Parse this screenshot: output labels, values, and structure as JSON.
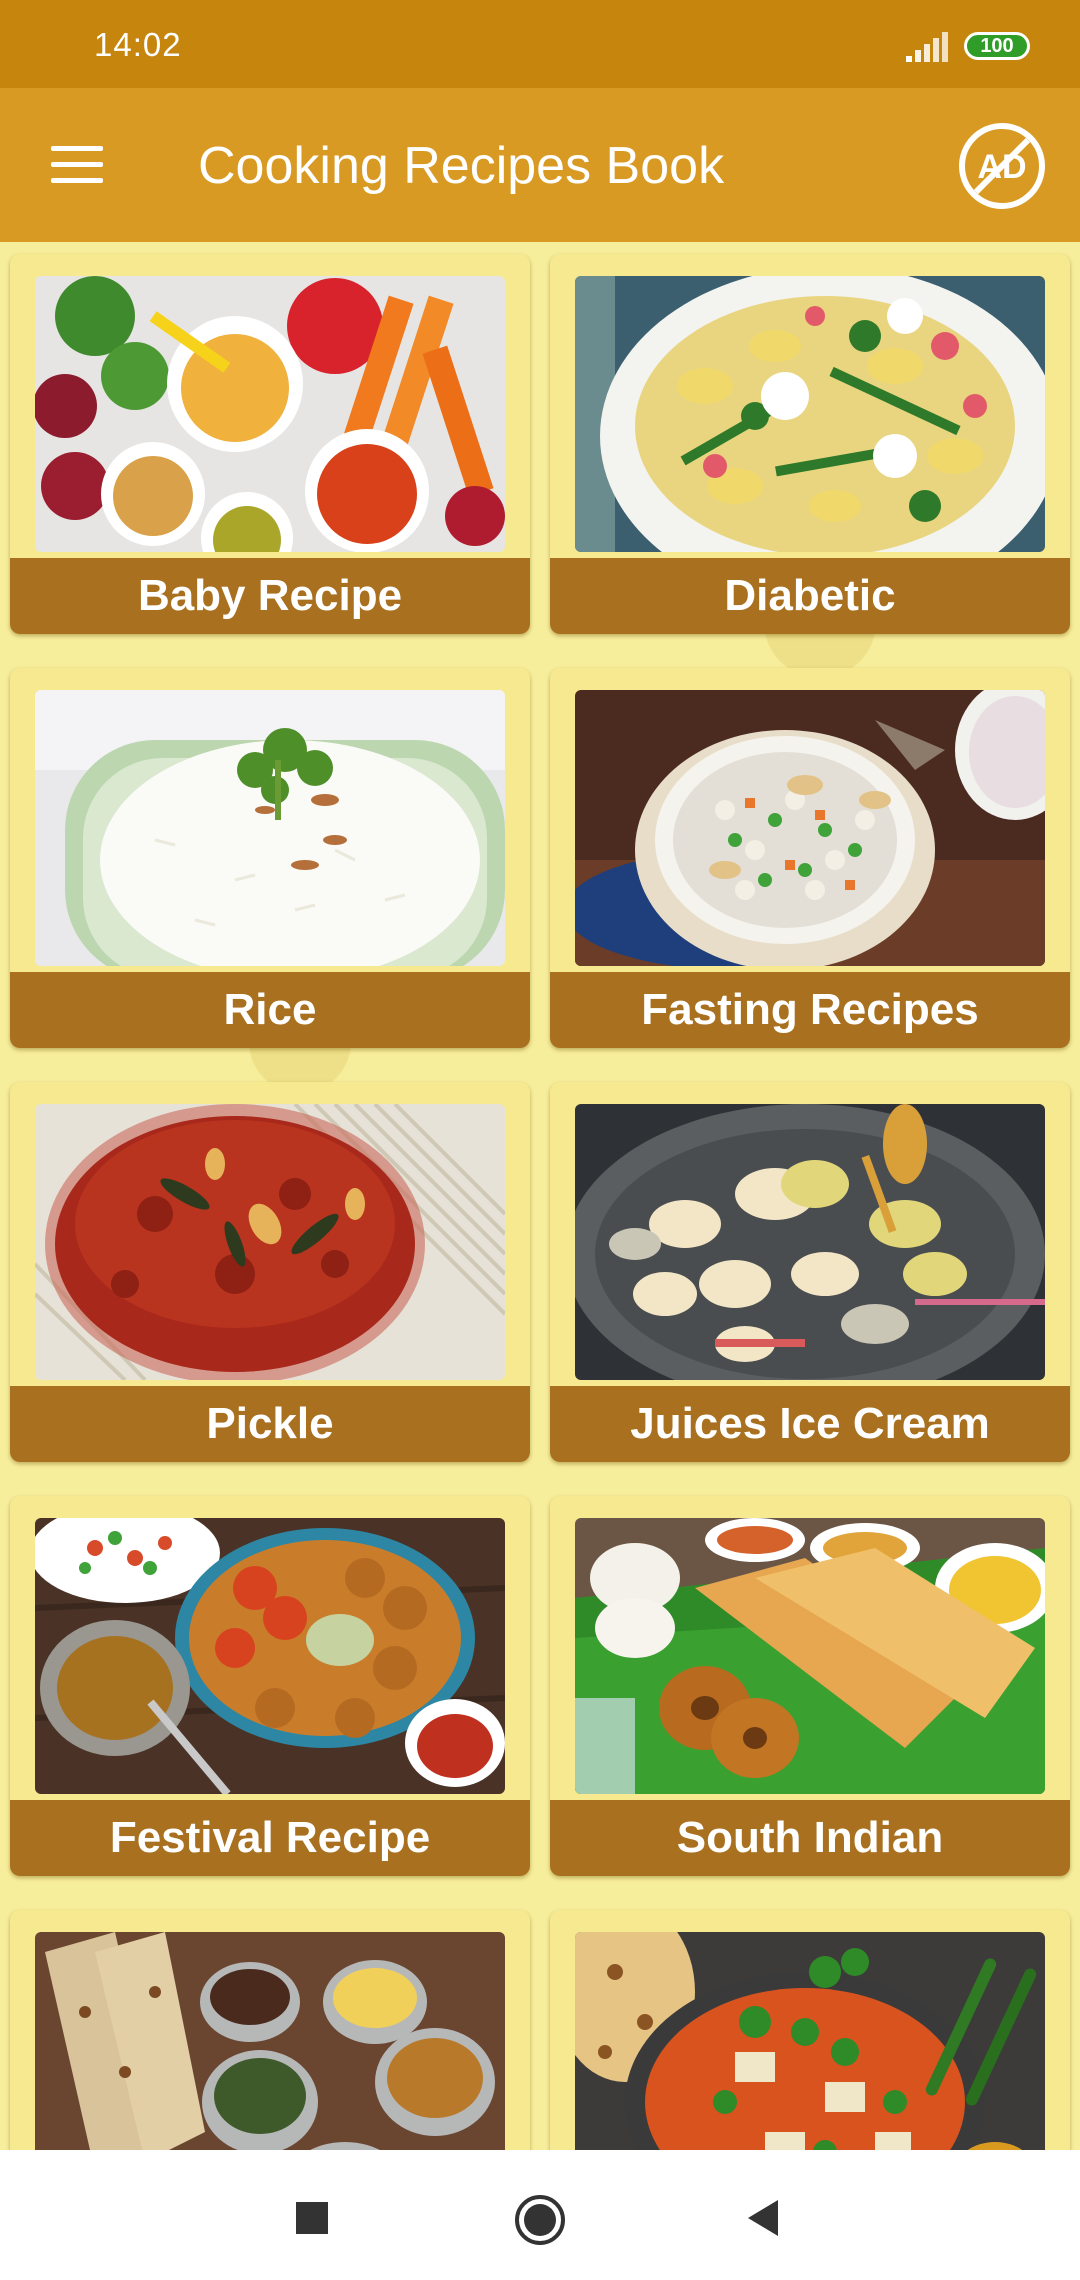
{
  "status_bar": {
    "time": "14:02",
    "battery": "100"
  },
  "app_bar": {
    "title": "Cooking Recipes Book",
    "menu_icon": "hamburger-menu-icon",
    "remove_ads_icon": "no-ad-icon",
    "remove_ads_text": "AD"
  },
  "categories": [
    {
      "label": "Baby Recipe",
      "photo_icon": "baby-food-photo"
    },
    {
      "label": "Diabetic",
      "photo_icon": "pasta-salad-photo"
    },
    {
      "label": "Rice",
      "photo_icon": "rice-bowl-photo"
    },
    {
      "label": "Fasting Recipes",
      "photo_icon": "sabudana-khichdi-photo"
    },
    {
      "label": "Pickle",
      "photo_icon": "pickle-jar-photo"
    },
    {
      "label": "Juices Ice Cream",
      "photo_icon": "kulfi-plate-photo"
    },
    {
      "label": "Festival Recipe",
      "photo_icon": "festival-platter-photo"
    },
    {
      "label": "South Indian",
      "photo_icon": "dosa-idli-photo"
    },
    {
      "label": "",
      "photo_icon": "naan-curries-photo"
    },
    {
      "label": "",
      "photo_icon": "paneer-curry-photo"
    }
  ],
  "nav_bar": {
    "recents_icon": "recents-square-icon",
    "home_icon": "home-circle-icon",
    "back_icon": "back-triangle-icon"
  },
  "colors": {
    "status_bar": "#c6850d",
    "app_bar": "#d89a22",
    "card_label": "#a8701f",
    "background": "#f6ec96"
  }
}
